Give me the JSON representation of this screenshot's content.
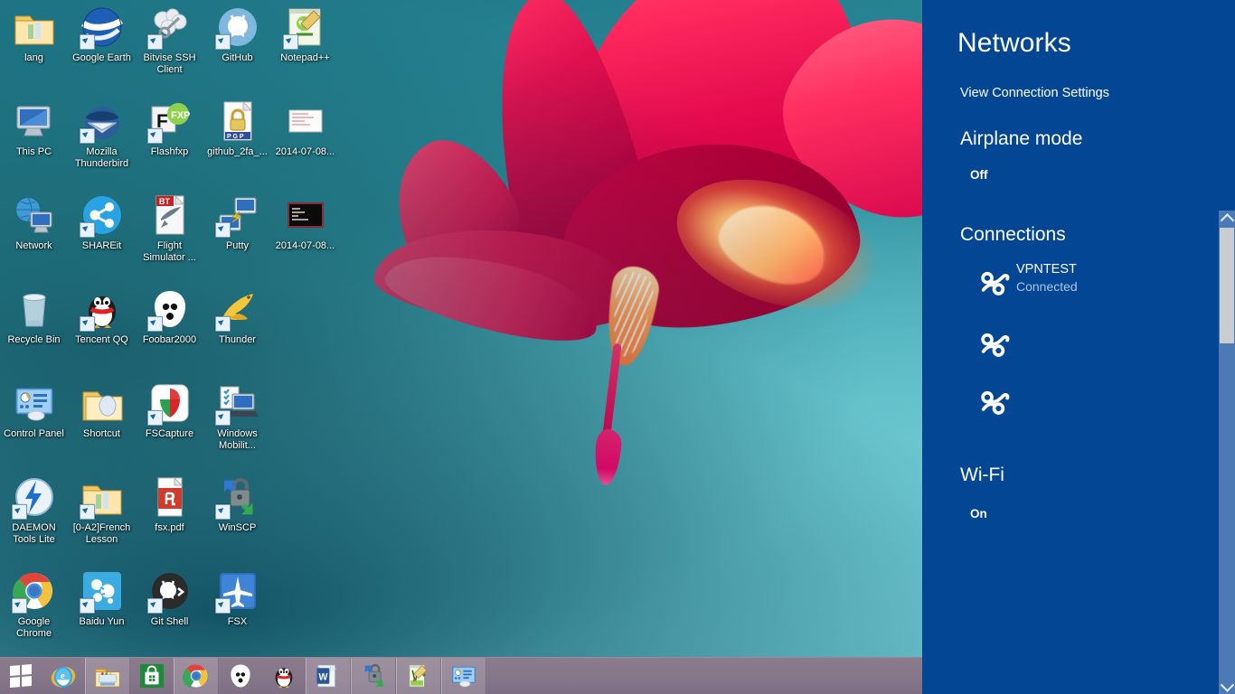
{
  "desktop": {
    "wallpaper_name": "christmas-cactus-flower",
    "icons": [
      {
        "label": "lang",
        "icon": "folder-icon",
        "shortcut": false,
        "col": 0,
        "row": 0
      },
      {
        "label": "Google Earth",
        "icon": "google-earth-icon",
        "shortcut": true,
        "col": 1,
        "row": 0
      },
      {
        "label": "Bitvise SSH Client",
        "icon": "bitvise-ssh-client-icon",
        "shortcut": true,
        "col": 2,
        "row": 0
      },
      {
        "label": "GitHub",
        "icon": "github-icon",
        "shortcut": true,
        "col": 3,
        "row": 0
      },
      {
        "label": "Notepad++",
        "icon": "notepad-plus-plus-icon",
        "shortcut": true,
        "col": 4,
        "row": 0
      },
      {
        "label": "This PC",
        "icon": "this-pc-icon",
        "shortcut": false,
        "col": 0,
        "row": 1
      },
      {
        "label": "Mozilla Thunderbird",
        "icon": "thunderbird-icon",
        "shortcut": true,
        "col": 1,
        "row": 1
      },
      {
        "label": "Flashfxp",
        "icon": "flashfxp-icon",
        "shortcut": true,
        "col": 2,
        "row": 1
      },
      {
        "label": "github_2fa_...",
        "icon": "pgp-file-icon",
        "shortcut": false,
        "col": 3,
        "row": 1
      },
      {
        "label": "2014-07-08...",
        "icon": "image-file-icon",
        "shortcut": false,
        "col": 4,
        "row": 1
      },
      {
        "label": "Network",
        "icon": "network-icon",
        "shortcut": false,
        "col": 0,
        "row": 2
      },
      {
        "label": "SHAREit",
        "icon": "shareit-icon",
        "shortcut": true,
        "col": 1,
        "row": 2
      },
      {
        "label": "Flight Simulator ...",
        "icon": "flight-simulator-torrent-icon",
        "shortcut": false,
        "col": 2,
        "row": 2
      },
      {
        "label": "Putty",
        "icon": "putty-icon",
        "shortcut": true,
        "col": 3,
        "row": 2
      },
      {
        "label": "2014-07-08...",
        "icon": "terminal-screenshot-icon",
        "shortcut": false,
        "col": 4,
        "row": 2
      },
      {
        "label": "Recycle Bin",
        "icon": "recycle-bin-icon",
        "shortcut": false,
        "col": 0,
        "row": 3
      },
      {
        "label": "Tencent QQ",
        "icon": "tencent-qq-icon",
        "shortcut": true,
        "col": 1,
        "row": 3
      },
      {
        "label": "Foobar2000",
        "icon": "foobar2000-icon",
        "shortcut": true,
        "col": 2,
        "row": 3
      },
      {
        "label": "Thunder",
        "icon": "thunder-icon",
        "shortcut": true,
        "col": 3,
        "row": 3
      },
      {
        "label": "Control Panel",
        "icon": "control-panel-icon",
        "shortcut": false,
        "col": 0,
        "row": 4
      },
      {
        "label": "Shortcut",
        "icon": "folder-shortcut-icon",
        "shortcut": false,
        "col": 1,
        "row": 4
      },
      {
        "label": "FSCapture",
        "icon": "fscapture-icon",
        "shortcut": true,
        "col": 2,
        "row": 4
      },
      {
        "label": "Windows Mobilit...",
        "icon": "windows-mobility-center-icon",
        "shortcut": true,
        "col": 3,
        "row": 4
      },
      {
        "label": "DAEMON Tools Lite",
        "icon": "daemon-tools-lite-icon",
        "shortcut": true,
        "col": 0,
        "row": 5
      },
      {
        "label": "[0-A2]French Lesson",
        "icon": "folder-icon",
        "shortcut": true,
        "col": 1,
        "row": 5
      },
      {
        "label": "fsx.pdf",
        "icon": "pdf-file-icon",
        "shortcut": false,
        "col": 2,
        "row": 5
      },
      {
        "label": "WinSCP",
        "icon": "winscp-icon",
        "shortcut": true,
        "col": 3,
        "row": 5
      },
      {
        "label": "Google Chrome",
        "icon": "google-chrome-icon",
        "shortcut": true,
        "col": 0,
        "row": 6
      },
      {
        "label": "Baidu Yun",
        "icon": "baidu-yun-icon",
        "shortcut": true,
        "col": 1,
        "row": 6
      },
      {
        "label": "Git Shell",
        "icon": "git-shell-icon",
        "shortcut": true,
        "col": 2,
        "row": 6
      },
      {
        "label": "FSX",
        "icon": "fsx-icon",
        "shortcut": true,
        "col": 3,
        "row": 6
      }
    ]
  },
  "taskbar": {
    "start_label": "Start",
    "items": [
      {
        "name": "internet-explorer",
        "label": "Internet Explorer",
        "active": false
      },
      {
        "name": "file-explorer",
        "label": "File Explorer",
        "active": true
      },
      {
        "name": "windows-store",
        "label": "Store",
        "active": false
      },
      {
        "name": "google-chrome",
        "label": "Google Chrome",
        "active": true
      },
      {
        "name": "foobar2000",
        "label": "Foobar2000",
        "active": false
      },
      {
        "name": "tencent-qq",
        "label": "Tencent QQ",
        "active": false
      },
      {
        "name": "microsoft-word",
        "label": "Microsoft Word",
        "active": true
      },
      {
        "name": "winscp",
        "label": "WinSCP",
        "active": true
      },
      {
        "name": "notepad-plus-plus",
        "label": "Notepad++",
        "active": true
      },
      {
        "name": "control-panel",
        "label": "Control Panel",
        "active": true
      }
    ]
  },
  "networks_panel": {
    "title": "Networks",
    "view_connection_settings": "View Connection Settings",
    "airplane_mode": {
      "heading": "Airplane mode",
      "state_label": "Off",
      "state": "off"
    },
    "connections": {
      "heading": "Connections",
      "items": [
        {
          "name": "VPNTEST",
          "status": "Connected",
          "icon": "vpn-connection-icon"
        },
        {
          "name": "",
          "status": "",
          "icon": "vpn-connection-icon"
        },
        {
          "name": "",
          "status": "",
          "icon": "vpn-connection-icon"
        }
      ]
    },
    "wifi": {
      "heading": "Wi-Fi",
      "state_label": "On",
      "state": "on"
    },
    "scrollbar": {
      "up_arrow": "scroll-up-icon",
      "down_arrow": "scroll-down-icon"
    },
    "colors": {
      "panel_background": "#034694",
      "toggle_on": "#00a2f3",
      "toggle_off_track": "#1157a6",
      "status_text": "#a9c6e4",
      "scrollbar_track": "#4c7ab5",
      "scrollbar_thumb": "#c9ccd1"
    }
  }
}
